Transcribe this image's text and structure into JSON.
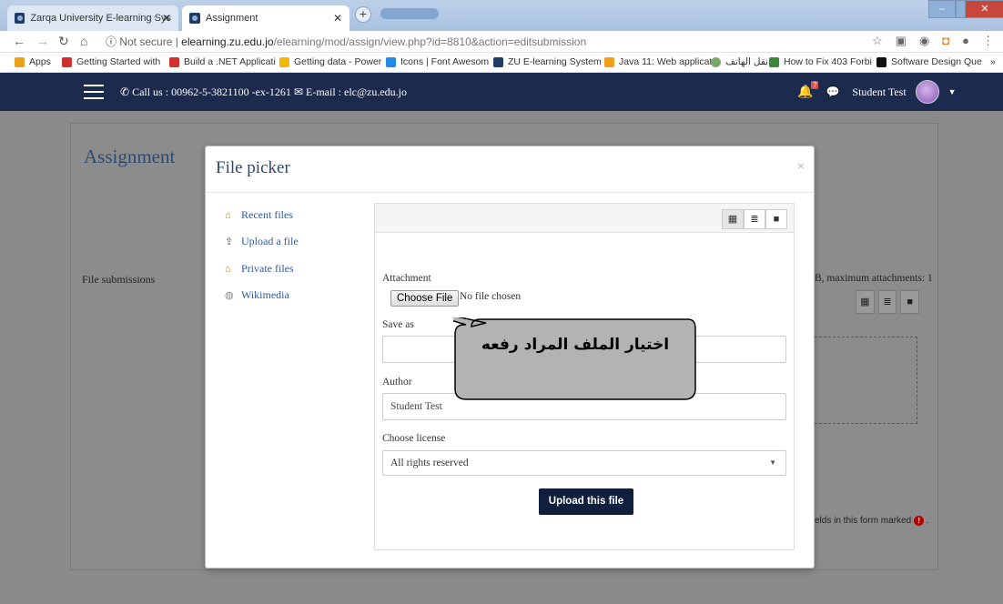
{
  "browser": {
    "tabs": [
      {
        "title": "Zarqa University E-learning Syste",
        "active": false
      },
      {
        "title": "Assignment",
        "active": true
      }
    ],
    "url": {
      "security": "Not secure",
      "host": "elearning.zu.edu.jo",
      "path": "/elearning/mod/assign/view.php?id=8810&action=editsubmission"
    },
    "bookmarks": [
      {
        "label": "Apps",
        "color": "#e8a21c"
      },
      {
        "label": "Getting Started with",
        "color": "#d0312d"
      },
      {
        "label": "Build a .NET Applicati",
        "color": "#d0312d"
      },
      {
        "label": "Getting data - Power",
        "color": "#f2b800"
      },
      {
        "label": "Icons | Font Awesom",
        "color": "#228ae6"
      },
      {
        "label": "ZU E-learning System",
        "color": "#1f3b66"
      },
      {
        "label": "Java 11: Web applicat",
        "color": "#f29f1c"
      },
      {
        "label": "نقل الهاتف",
        "color": "#7aa86b"
      },
      {
        "label": "How to Fix 403 Forbi",
        "color": "#3a8a3a"
      },
      {
        "label": "Software Design Que",
        "color": "#111111"
      }
    ]
  },
  "site": {
    "contact": "Call us : 00962-5-3821100 -ex-1261",
    "email": "E-mail : elc@zu.edu.jo",
    "notification_count": "7",
    "user_name": "Student Test",
    "navbar_color": "#1c2a4e"
  },
  "page": {
    "title": "Assignment",
    "file_submissions_label": "File submissions",
    "max_info": "B, maximum attachments: 1",
    "required_note": "elds in this form marked"
  },
  "modal": {
    "title": "File picker",
    "close": "×",
    "repositories": [
      {
        "label": "Recent files",
        "icon": "recent-files-icon"
      },
      {
        "label": "Upload a file",
        "icon": "upload-icon"
      },
      {
        "label": "Private files",
        "icon": "private-files-icon"
      },
      {
        "label": "Wikimedia",
        "icon": "wikimedia-icon"
      }
    ],
    "attachment_label": "Attachment",
    "choose_file_button": "Choose File",
    "no_file_text": "No file chosen",
    "save_as_label": "Save as",
    "save_as_value": "",
    "author_label": "Author",
    "author_value": "Student Test",
    "license_label": "Choose license",
    "license_value": "All rights reserved",
    "upload_button": "Upload this file",
    "upload_button_color": "#0f1f3d"
  },
  "callout": {
    "text": "اختيار الملف المراد رفعه"
  }
}
